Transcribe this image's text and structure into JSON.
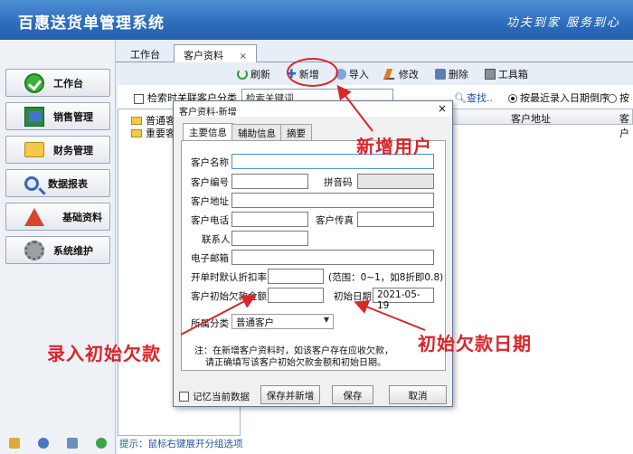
{
  "app": {
    "title": "百惠送货单管理系统",
    "slogan": "功夫到家  服务到心"
  },
  "sidebar": {
    "items": [
      {
        "label": "工作台",
        "icon": "check-icon"
      },
      {
        "label": "销售管理",
        "icon": "sales-icon"
      },
      {
        "label": "财务管理",
        "icon": "folder-icon"
      },
      {
        "label": "数据报表",
        "icon": "magnifier-icon"
      },
      {
        "label": "基础资料",
        "icon": "pyramid-icon"
      },
      {
        "label": "系统维护",
        "icon": "gear-icon"
      }
    ]
  },
  "tabs": {
    "workbench": "工作台",
    "customer": "客户资料",
    "close": "×"
  },
  "toolbar": {
    "refresh": "刷新",
    "add": "新增",
    "import": "导入",
    "edit": "修改",
    "delete": "删除",
    "tools": "工具箱"
  },
  "search": {
    "checkbox_label": "检索时关联客户分类",
    "placeholder": "检索关键词",
    "find": "查找..",
    "sort_recent": "按最近录入日期倒序",
    "sort_other": "按"
  },
  "tree": {
    "items": [
      "普通客户",
      "重要客户"
    ]
  },
  "grid": {
    "columns": [
      "客户地址",
      "客户"
    ]
  },
  "hint": "提示：鼠标右键展开分组选项",
  "dialog": {
    "title": "客户资料-新增",
    "close": "×",
    "tabs": [
      "主要信息",
      "辅助信息",
      "摘要"
    ],
    "fields": {
      "name_label": "客户名称",
      "code_label": "客户编号",
      "pinyin_label": "拼音码",
      "address_label": "客户地址",
      "phone_label": "客户电话",
      "fax_label": "客户传真",
      "contact_label": "联系人",
      "email_label": "电子邮箱",
      "discount_label": "开单时默认折扣率",
      "discount_range": "(范围：0~1，如8折即0.8)",
      "initial_debt_label": "客户初始欠款金额",
      "initial_date_label": "初始日期",
      "initial_date_value": "2021-05-19",
      "category_label": "所属分类",
      "category_value": "普通客户"
    },
    "note_line1": "注：在新增客户资料时，如该客户存在应收欠款，",
    "note_line2": "请正确填写该客户初始欠款金额和初始日期。",
    "remember": "记忆当前数据",
    "save_and_new": "保存并新增",
    "save": "保存",
    "cancel": "取消"
  },
  "annotations": {
    "add_user": "新增用户",
    "enter_debt": "录入初始欠款",
    "debt_date": "初始欠款日期"
  },
  "colors": {
    "titlebar": "#2c6cbb",
    "annotation": "#d8262a",
    "link": "#1a4fb5"
  }
}
